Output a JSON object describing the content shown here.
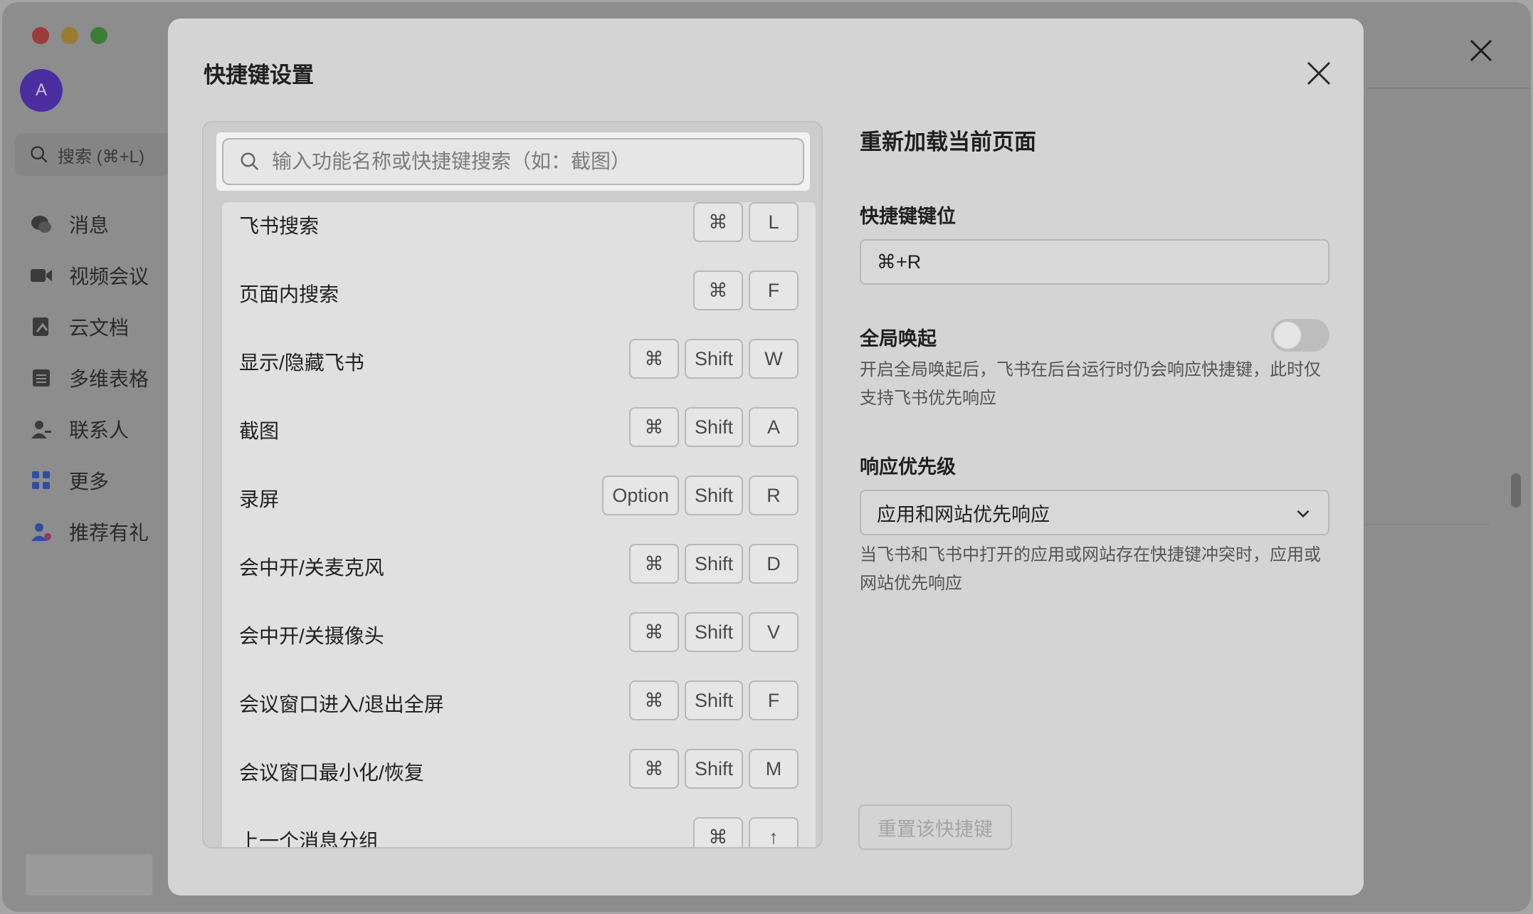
{
  "sidebar": {
    "avatar_letter": "A",
    "search_placeholder": "搜索 (⌘+L)",
    "items": [
      {
        "label": "消息",
        "icon": "chat-icon"
      },
      {
        "label": "视频会议",
        "icon": "video-icon"
      },
      {
        "label": "云文档",
        "icon": "docs-icon"
      },
      {
        "label": "多维表格",
        "icon": "table-icon"
      },
      {
        "label": "联系人",
        "icon": "contacts-icon"
      },
      {
        "label": "更多",
        "icon": "more-apps-icon"
      },
      {
        "label": "推荐有礼",
        "icon": "gift-user-icon"
      }
    ]
  },
  "modal": {
    "title": "快捷键设置",
    "search_placeholder": "输入功能名称或快捷键搜索（如：截图）",
    "shortcuts": [
      {
        "label": "飞书搜索",
        "keys": [
          "⌘",
          "L"
        ]
      },
      {
        "label": "页面内搜索",
        "keys": [
          "⌘",
          "F"
        ]
      },
      {
        "label": "显示/隐藏飞书",
        "keys": [
          "⌘",
          "Shift",
          "W"
        ]
      },
      {
        "label": "截图",
        "keys": [
          "⌘",
          "Shift",
          "A"
        ]
      },
      {
        "label": "录屏",
        "keys": [
          "Option",
          "Shift",
          "R"
        ]
      },
      {
        "label": "会中开/关麦克风",
        "keys": [
          "⌘",
          "Shift",
          "D"
        ]
      },
      {
        "label": "会中开/关摄像头",
        "keys": [
          "⌘",
          "Shift",
          "V"
        ]
      },
      {
        "label": "会议窗口进入/退出全屏",
        "keys": [
          "⌘",
          "Shift",
          "F"
        ]
      },
      {
        "label": "会议窗口最小化/恢复",
        "keys": [
          "⌘",
          "Shift",
          "M"
        ]
      },
      {
        "label": "上一个消息分组",
        "keys": [
          "⌘",
          "↑"
        ]
      }
    ],
    "detail": {
      "title": "重新加载当前页面",
      "keybind_label": "快捷键键位",
      "keybind_value": "⌘+R",
      "global_label": "全局唤起",
      "global_enabled": false,
      "global_desc": "开启全局唤起后，飞书在后台运行时仍会响应快捷键，此时仅支持飞书优先响应",
      "priority_label": "响应优先级",
      "priority_value": "应用和网站优先响应",
      "priority_desc": "当飞书和飞书中打开的应用或网站存在快捷键冲突时，应用或网站优先响应",
      "reset_label": "重置该快捷键"
    }
  }
}
